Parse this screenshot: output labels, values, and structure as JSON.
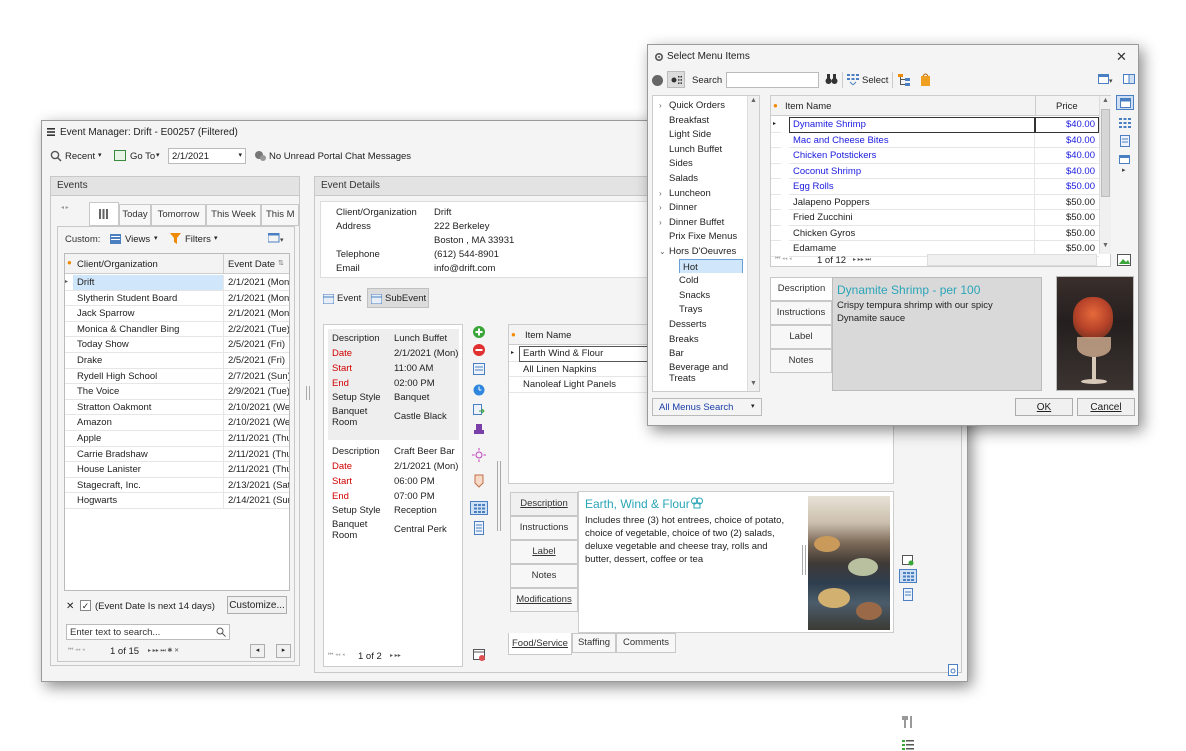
{
  "em": {
    "title": "Event Manager: Drift - E00257 (Filtered)",
    "toolbar": {
      "recent": "Recent",
      "goto": "Go To",
      "date": "2/1/2021",
      "portal": "No Unread Portal Chat Messages"
    },
    "events": {
      "header": "Events",
      "tabs": [
        "Today",
        "Tomorrow",
        "This Week",
        "This M"
      ],
      "custom_label": "Custom:",
      "views": "Views",
      "filters": "Filters",
      "columns": [
        "Client/Organization",
        "Event Date"
      ],
      "rows": [
        [
          "Drift",
          "2/1/2021 (Mon)"
        ],
        [
          "Slytherin Student Board",
          "2/1/2021 (Mon)"
        ],
        [
          "Jack Sparrow",
          "2/1/2021 (Mon)"
        ],
        [
          "Monica & Chandler Bing",
          "2/2/2021 (Tue)"
        ],
        [
          "Today Show",
          "2/5/2021 (Fri)"
        ],
        [
          "Drake",
          "2/5/2021 (Fri)"
        ],
        [
          "Rydell High School",
          "2/7/2021 (Sun)"
        ],
        [
          "The Voice",
          "2/9/2021 (Tue)"
        ],
        [
          "Stratton Oakmont",
          "2/10/2021 (Wed"
        ],
        [
          "Amazon",
          "2/10/2021 (Wed"
        ],
        [
          "Apple",
          "2/11/2021 (Thu"
        ],
        [
          "Carrie Bradshaw",
          "2/11/2021 (Thu"
        ],
        [
          "House Lanister",
          "2/11/2021 (Thu"
        ],
        [
          "Stagecraft, Inc.",
          "2/13/2021 (Sat)"
        ],
        [
          "Hogwarts",
          "2/14/2021 (Sun"
        ]
      ],
      "filter_text": "(Event Date Is next 14 days)",
      "customize": "Customize...",
      "search_placeholder": "Enter text to search...",
      "pager": "1 of 15"
    },
    "details": {
      "header": "Event Details",
      "client_label": "Client/Organization",
      "client": "Drift",
      "address_label": "Address",
      "address1": "222 Berkeley",
      "address2": "Boston , MA 33931",
      "telephone_label": "Telephone",
      "telephone": "(612) 544-8901",
      "email_label": "Email",
      "email": "info@drift.com",
      "tab_event": "Event",
      "tab_subevent": "SubEvent",
      "sub1": {
        "description": "Lunch Buffet",
        "date": "2/1/2021 (Mon)",
        "start": "11:00 AM",
        "end": "02:00 PM",
        "setup": "Banquet",
        "room": "Castle Black"
      },
      "sub2": {
        "description": "Craft Beer Bar",
        "date": "2/1/2021 (Mon)",
        "start": "06:00 PM",
        "end": "07:00 PM",
        "setup": "Reception",
        "room": "Central Perk"
      },
      "labels": {
        "description": "Description",
        "date": "Date",
        "start": "Start",
        "end": "End",
        "setup": "Setup Style",
        "room1": "Banquet",
        "room2": "Room"
      },
      "sub_pager": "1 of 2",
      "items_header": "Item Name",
      "items": [
        "Earth Wind & Flour",
        "All Linen Napkins",
        "Nanoleaf Light Panels"
      ],
      "item_tabs": [
        "Description",
        "Instructions",
        "Label",
        "Notes",
        "Modifications"
      ],
      "item_title": "Earth, Wind & Flour",
      "item_desc": "Includes three (3) hot entrees, choice of potato, choice of vegetable, choice of two (2) salads, deluxe vegetable and cheese tray, rolls and butter, dessert, coffee or tea",
      "bottom_tabs": [
        "Food/Service",
        "Staffing",
        "Comments"
      ]
    }
  },
  "smi": {
    "title": "Select Menu Items",
    "search_label": "Search",
    "select_label": "Select",
    "categories": [
      {
        "label": "Quick Orders",
        "arrow": true
      },
      {
        "label": "Breakfast",
        "arrow": false
      },
      {
        "label": "Light Side",
        "arrow": false
      },
      {
        "label": "Lunch Buffet",
        "arrow": false
      },
      {
        "label": "Sides",
        "arrow": false
      },
      {
        "label": "Salads",
        "arrow": false
      },
      {
        "label": "Luncheon",
        "arrow": true
      },
      {
        "label": "Dinner",
        "arrow": true
      },
      {
        "label": "Dinner Buffet",
        "arrow": true
      },
      {
        "label": "Prix Fixe Menus",
        "arrow": false
      },
      {
        "label": "Hors D'Oeuvres",
        "arrow": true,
        "open": true
      }
    ],
    "subcategories": [
      "Hot",
      "Cold",
      "Snacks",
      "Trays"
    ],
    "categories_after": [
      "Desserts",
      "Breaks",
      "Bar",
      "Beverage and Treats"
    ],
    "col_item": "Item Name",
    "col_price": "Price",
    "items": [
      {
        "name": "Dynamite Shrimp",
        "price": "$40.00",
        "blue": true
      },
      {
        "name": "Mac and Cheese Bites",
        "price": "$40.00",
        "blue": true
      },
      {
        "name": "Chicken Potstickers",
        "price": "$40.00",
        "blue": true
      },
      {
        "name": "Coconut Shrimp",
        "price": "$40.00",
        "blue": true
      },
      {
        "name": "Egg Rolls",
        "price": "$50.00",
        "blue": true
      },
      {
        "name": "Jalapeno Poppers",
        "price": "$50.00",
        "blue": false
      },
      {
        "name": "Fried Zucchini",
        "price": "$50.00",
        "blue": false
      },
      {
        "name": "Chicken Gyros",
        "price": "$50.00",
        "blue": false
      },
      {
        "name": "Edamame",
        "price": "$50.00",
        "blue": false
      }
    ],
    "pager": "1 of 12",
    "detail_tabs": [
      "Description",
      "Instructions",
      "Label",
      "Notes"
    ],
    "detail_title": "Dynamite Shrimp - per 100",
    "detail_desc": "Crispy tempura shrimp with our spicy Dynamite sauce",
    "all_menus": "All Menus Search",
    "ok": "OK",
    "cancel": "Cancel"
  }
}
